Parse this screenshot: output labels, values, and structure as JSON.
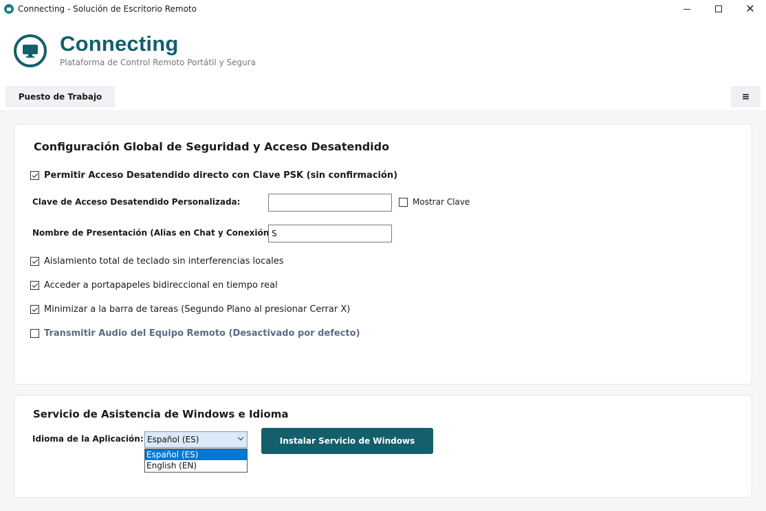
{
  "window": {
    "title": "Connecting - Solución de Escritorio Remoto",
    "close_symbol": "✕"
  },
  "header": {
    "app_name": "Connecting",
    "subtitle": "Plataforma de Control Remoto Portátil y Segura",
    "logo_icon": "monitor-icon"
  },
  "tabs": {
    "work": "Puesto de Trabajo",
    "menu_symbol": "≡"
  },
  "security": {
    "title": "Configuración Global de Seguridad y Acceso Desatendido",
    "unattended_label": "Permitir Acceso Desatendido directo con Clave PSK (sin confirmación)",
    "unattended_checked": true,
    "password_label": "Clave de Acceso Desatendido Personalizada:",
    "password_value": "",
    "show_password_label": "Mostrar Clave",
    "show_password_checked": false,
    "display_name_label": "Nombre de Presentación (Alias en Chat y Conexión):",
    "display_name_value": "S",
    "options": [
      {
        "label": "Aislamiento total de teclado sin interferencias locales",
        "checked": true
      },
      {
        "label": "Acceder a portapapeles bidireccional en tiempo real",
        "checked": true
      },
      {
        "label": "Minimizar a la barra de tareas (Segundo Plano al presionar Cerrar X)",
        "checked": true
      },
      {
        "label": "Transmitir Audio del Equipo Remoto (Desactivado por defecto)",
        "checked": false
      }
    ]
  },
  "service": {
    "title": "Servicio de Asistencia de Windows e Idioma",
    "language_label": "Idioma de la Aplicación:",
    "language_selected": "Español (ES)",
    "language_options": [
      "Español (ES)",
      "English (EN)"
    ],
    "install_button": "Instalar Servicio de Windows"
  },
  "colors": {
    "accent": "#135f6b",
    "selection": "#0078d7"
  }
}
